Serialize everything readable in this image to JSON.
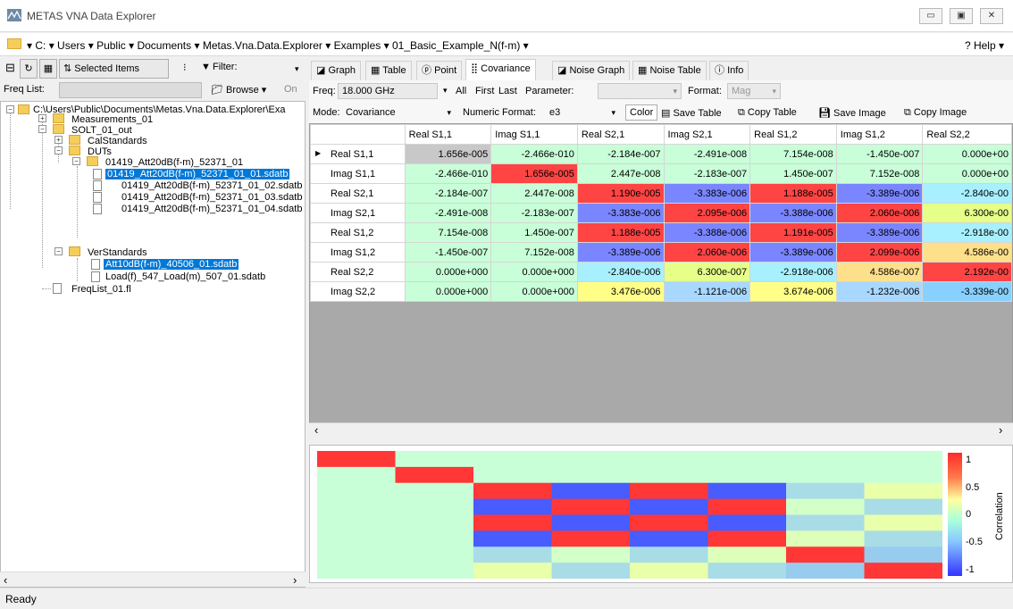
{
  "window": {
    "title": "METAS VNA Data Explorer"
  },
  "address": {
    "crumbs": "▾ C: ▾ Users ▾ Public ▾ Documents ▾ Metas.Vna.Data.Explorer ▾ Examples ▾ 01_Basic_Example_N(f-m) ▾",
    "help": "? Help ▾"
  },
  "left_toolbar": {
    "selected_items": "Selected Items",
    "filter": "Filter:",
    "freq_list_label": "Freq List:",
    "browse": "Browse",
    "on": "On"
  },
  "tree": {
    "root": "C:\\Users\\Public\\Documents\\Metas.Vna.Data.Explorer\\Exa",
    "measurements": "Measurements_01",
    "solt": "SOLT_01_out",
    "calstandards": "CalStandards",
    "duts": "DUTs",
    "dut_folder": "01419_Att20dB(f-m)_52371_01",
    "dut_files": [
      "01419_Att20dB(f-m)_52371_01_01.sdatb",
      "01419_Att20dB(f-m)_52371_01_02.sdatb",
      "01419_Att20dB(f-m)_52371_01_03.sdatb",
      "01419_Att20dB(f-m)_52371_01_04.sdatb"
    ],
    "verstandards": "VerStandards",
    "ver_files": [
      "Att10dB(f-m)_40506_01.sdatb",
      "Load(f)_547_Load(m)_507_01.sdatb"
    ],
    "freqlist": "FreqList_01.fl"
  },
  "tabs": [
    "Graph",
    "Table",
    "Point",
    "Covariance",
    "Noise Graph",
    "Noise Table",
    "Info"
  ],
  "options": {
    "freq_label": "Freq:",
    "freq_value": "18.000 GHz",
    "all": "All",
    "first": "First",
    "last": "Last",
    "parameter_label": "Parameter:",
    "format_label": "Format:",
    "format_value": "Mag",
    "mode_label": "Mode:",
    "mode_value": "Covariance",
    "numeric_label": "Numeric Format:",
    "numeric_value": "e3",
    "color": "Color",
    "save_table": "Save Table",
    "copy_table": "Copy Table",
    "save_image": "Save Image",
    "copy_image": "Copy Image"
  },
  "grid": {
    "columns": [
      "Real S1,1",
      "Imag S1,1",
      "Real S2,1",
      "Imag S2,1",
      "Real S1,2",
      "Imag S1,2",
      "Real S2,2"
    ],
    "rows": [
      {
        "label": "Real S1,1",
        "cells": [
          "1.656e-005",
          "-2.466e-010",
          "-2.184e-007",
          "-2.491e-008",
          "7.154e-008",
          "-1.450e-007",
          "0.000e+00"
        ]
      },
      {
        "label": "Imag S1,1",
        "cells": [
          "-2.466e-010",
          "1.656e-005",
          "2.447e-008",
          "-2.183e-007",
          "1.450e-007",
          "7.152e-008",
          "0.000e+00"
        ]
      },
      {
        "label": "Real S2,1",
        "cells": [
          "-2.184e-007",
          "2.447e-008",
          "1.190e-005",
          "-3.383e-006",
          "1.188e-005",
          "-3.389e-006",
          "-2.840e-00"
        ]
      },
      {
        "label": "Imag S2,1",
        "cells": [
          "-2.491e-008",
          "-2.183e-007",
          "-3.383e-006",
          "2.095e-006",
          "-3.388e-006",
          "2.060e-006",
          "6.300e-00"
        ]
      },
      {
        "label": "Real S1,2",
        "cells": [
          "7.154e-008",
          "1.450e-007",
          "1.188e-005",
          "-3.388e-006",
          "1.191e-005",
          "-3.389e-006",
          "-2.918e-00"
        ]
      },
      {
        "label": "Imag S1,2",
        "cells": [
          "-1.450e-007",
          "7.152e-008",
          "-3.389e-006",
          "2.060e-006",
          "-3.389e-006",
          "2.099e-006",
          "4.586e-00"
        ]
      },
      {
        "label": "Real S2,2",
        "cells": [
          "0.000e+000",
          "0.000e+000",
          "-2.840e-006",
          "6.300e-007",
          "-2.918e-006",
          "4.586e-007",
          "2.192e-00"
        ]
      },
      {
        "label": "Imag S2,2",
        "cells": [
          "0.000e+000",
          "0.000e+000",
          "3.476e-006",
          "-1.121e-006",
          "3.674e-006",
          "-1.232e-006",
          "-3.339e-00"
        ]
      }
    ],
    "cell_colors": [
      [
        "#c8c8c8",
        "#c8ffd8",
        "#c8ffd8",
        "#c8ffd8",
        "#c8ffd8",
        "#c8ffd8",
        "#c8ffd8"
      ],
      [
        "#c8ffd8",
        "#ff4444",
        "#c8ffd8",
        "#c8ffd8",
        "#c8ffd8",
        "#c8ffd8",
        "#c8ffd8"
      ],
      [
        "#c8ffd8",
        "#c8ffd8",
        "#ff4444",
        "#7a86ff",
        "#ff4444",
        "#7a86ff",
        "#a8f0ff"
      ],
      [
        "#c8ffd8",
        "#c8ffd8",
        "#7a86ff",
        "#ff4444",
        "#7a86ff",
        "#ff4444",
        "#e6ff88"
      ],
      [
        "#c8ffd8",
        "#c8ffd8",
        "#ff4444",
        "#7a86ff",
        "#ff4444",
        "#7a86ff",
        "#a8f0ff"
      ],
      [
        "#c8ffd8",
        "#c8ffd8",
        "#7a86ff",
        "#ff4444",
        "#7a86ff",
        "#ff4444",
        "#ffe08a"
      ],
      [
        "#c8ffd8",
        "#c8ffd8",
        "#a8f0ff",
        "#e6ff88",
        "#a8f0ff",
        "#ffe08a",
        "#ff4444"
      ],
      [
        "#c8ffd8",
        "#c8ffd8",
        "#ffff88",
        "#a8d8ff",
        "#ffff88",
        "#a8d8ff",
        "#88d0ff"
      ]
    ]
  },
  "heatmap": {
    "matrix": [
      [
        1,
        0,
        0,
        0,
        0,
        0,
        0,
        0
      ],
      [
        0,
        1,
        0,
        0,
        0,
        0,
        0,
        0
      ],
      [
        0,
        0,
        1,
        -0.8,
        1,
        -0.8,
        -0.2,
        0.3
      ],
      [
        0,
        0,
        -0.8,
        1,
        -0.8,
        1,
        0.1,
        -0.2
      ],
      [
        0,
        0,
        1,
        -0.8,
        1,
        -0.8,
        -0.2,
        0.3
      ],
      [
        0,
        0,
        -0.8,
        1,
        -0.8,
        1,
        0.2,
        -0.2
      ],
      [
        0,
        0,
        -0.2,
        0.1,
        -0.2,
        0.2,
        1,
        -0.3
      ],
      [
        0,
        0,
        0.3,
        -0.2,
        0.3,
        -0.2,
        -0.3,
        1
      ]
    ],
    "colorbar_labels": [
      "1",
      "0.5",
      "0",
      "-0.5",
      "-1"
    ],
    "colorbar_title": "Correlation"
  },
  "status": {
    "text": "Ready"
  }
}
